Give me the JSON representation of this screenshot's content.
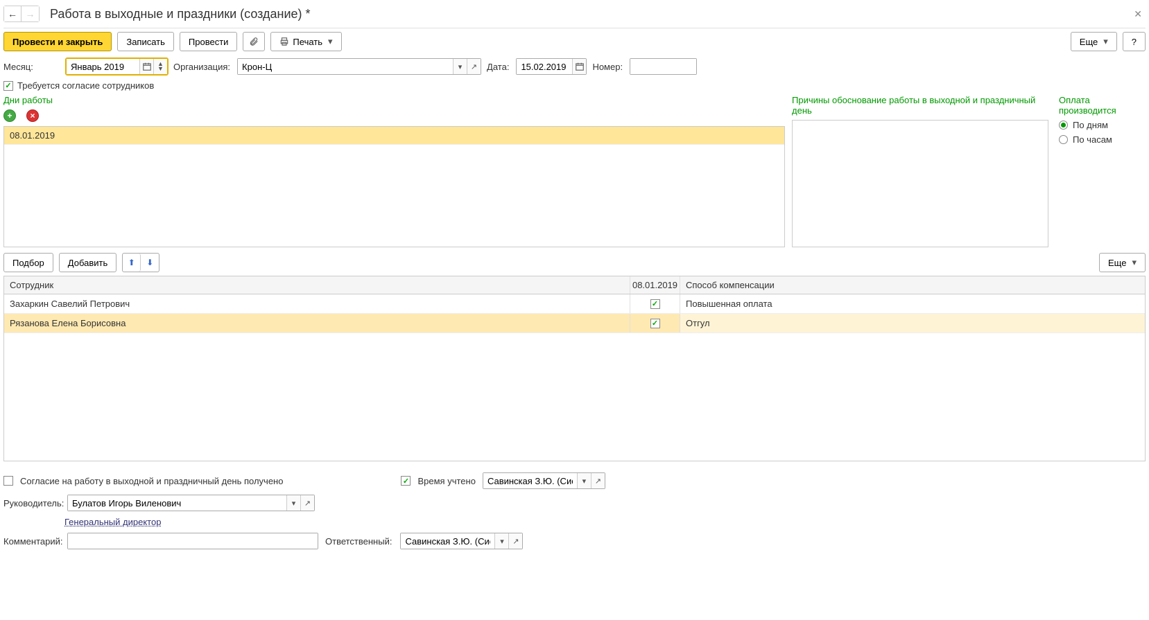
{
  "header": {
    "title": "Работа в выходные и праздники (создание) *"
  },
  "toolbar": {
    "post_close": "Провести и закрыть",
    "save": "Записать",
    "post": "Провести",
    "print": "Печать",
    "more": "Еще",
    "help": "?"
  },
  "fields": {
    "month_label": "Месяц:",
    "month_value": "Январь 2019",
    "org_label": "Организация:",
    "org_value": "Крон-Ц",
    "date_label": "Дата:",
    "date_value": "15.02.2019",
    "number_label": "Номер:",
    "number_value": ""
  },
  "consent_checkbox": "Требуется согласие сотрудников",
  "days": {
    "title": "Дни работы",
    "items": [
      "08.01.2019"
    ]
  },
  "reasons_title": "Причины обоснование работы в выходной и праздничный день",
  "payment": {
    "title": "Оплата производится",
    "by_days": "По дням",
    "by_hours": "По часам"
  },
  "emp_toolbar": {
    "pick": "Подбор",
    "add": "Добавить",
    "more": "Еще"
  },
  "emp_table": {
    "col_employee": "Сотрудник",
    "col_date": "08.01.2019",
    "col_comp": "Способ компенсации",
    "rows": [
      {
        "name": "Захаркин Савелий Петрович",
        "checked": true,
        "comp": "Повышенная оплата"
      },
      {
        "name": "Рязанова Елена Борисовна",
        "checked": true,
        "comp": "Отгул"
      }
    ]
  },
  "bottom": {
    "consent_received": "Согласие на работу в выходной и праздничный день получено",
    "time_accounted": "Время учтено",
    "accountant": "Савинская З.Ю. (Системн",
    "manager_label": "Руководитель:",
    "manager_value": "Булатов Игорь Виленович",
    "manager_position": "Генеральный директор",
    "comment_label": "Комментарий:",
    "comment_value": "",
    "responsible_label": "Ответственный:",
    "responsible_value": "Савинская З.Ю. (Системн"
  }
}
